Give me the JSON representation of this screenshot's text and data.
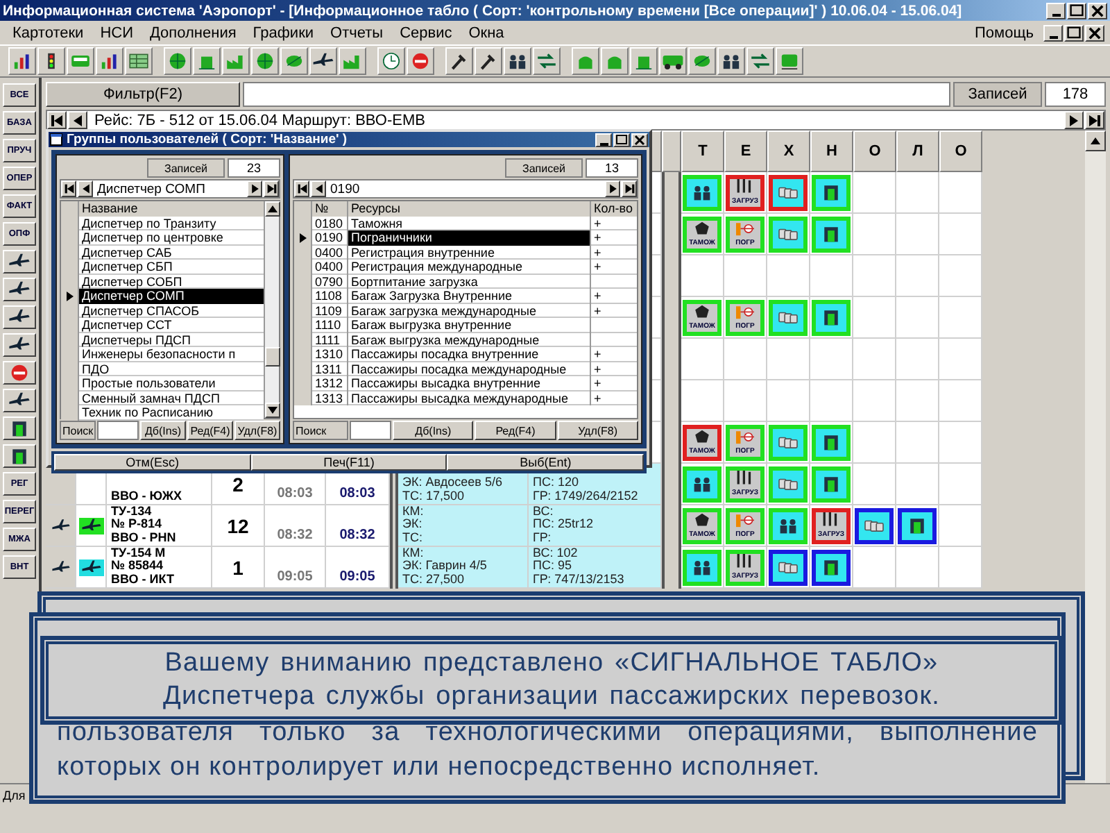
{
  "window": {
    "title": "Информационная система 'Аэропорт' - [Информационное табло ( Сорт: 'контрольному времени [Все операции]' ) 10.06.04 - 15.06.04]"
  },
  "menu": {
    "items": [
      "Картотеки",
      "НСИ",
      "Дополнения",
      "Графики",
      "Отчеты",
      "Сервис",
      "Окна"
    ],
    "help": "Помощь"
  },
  "toolbar": {
    "groups": [
      [
        {
          "kind": "chart"
        },
        {
          "kind": "traffic-light"
        },
        {
          "kind": "bus"
        },
        {
          "kind": "chart"
        },
        {
          "kind": "table"
        }
      ],
      [
        {
          "kind": "globe"
        },
        {
          "kind": "building"
        },
        {
          "kind": "factory"
        },
        {
          "kind": "globe"
        },
        {
          "kind": "leaf"
        },
        {
          "kind": "plane"
        },
        {
          "kind": "factory"
        }
      ],
      [
        {
          "kind": "clock"
        },
        {
          "kind": "no-entry"
        }
      ],
      [
        {
          "kind": "hammer"
        },
        {
          "kind": "hammer"
        },
        {
          "kind": "people"
        },
        {
          "kind": "arrows"
        }
      ],
      [
        {
          "kind": "bag"
        },
        {
          "kind": "bag"
        },
        {
          "kind": "building"
        },
        {
          "kind": "car"
        },
        {
          "kind": "leaf"
        },
        {
          "kind": "people"
        },
        {
          "kind": "arrows"
        },
        {
          "kind": "train"
        }
      ]
    ]
  },
  "sidebar": {
    "items": [
      {
        "kind": "text",
        "label": "ВСЕ"
      },
      {
        "kind": "text",
        "label": "БАЗА"
      },
      {
        "kind": "text",
        "label": "ПРУЧ"
      },
      {
        "kind": "text",
        "label": "ОПЕР"
      },
      {
        "kind": "text",
        "label": "ФАКТ"
      },
      {
        "kind": "text",
        "label": "ОПФ"
      },
      {
        "kind": "plane"
      },
      {
        "kind": "plane"
      },
      {
        "kind": "plane"
      },
      {
        "kind": "plane"
      },
      {
        "kind": "no-entry"
      },
      {
        "kind": "plane"
      },
      {
        "kind": "gate"
      },
      {
        "kind": "gate"
      },
      {
        "kind": "text",
        "label": "РЕГ"
      },
      {
        "kind": "text",
        "label": "ПЕРЕГ"
      },
      {
        "kind": "text",
        "label": "МЖА"
      },
      {
        "kind": "text",
        "label": "ВНТ"
      }
    ]
  },
  "filter": {
    "button": "Фильтр(F2)",
    "records_label": "Записей",
    "records": "178"
  },
  "nav": {
    "text": "Рейс: 7Б - 512 от 15.06.04 Маршрут: ВВО-ЕМВ"
  },
  "board": {
    "op_columns": [
      "Т",
      "Е",
      "Х",
      "Н",
      "О",
      "Л",
      "О"
    ],
    "rows": [
      {
        "ops": [
          {
            "kind": "people",
            "color": "#22e022"
          },
          {
            "kind": "food",
            "label": "ЗАГРУЗ",
            "color": "#e02020"
          },
          {
            "kind": "bags",
            "color": "#e02020"
          },
          {
            "kind": "gate",
            "color": "#22e022"
          }
        ]
      },
      {
        "ops": [
          {
            "kind": "customs",
            "label": "ТАМОЖ",
            "color": "#22e022"
          },
          {
            "kind": "border",
            "label": "ПОГР",
            "color": "#22e022"
          },
          {
            "kind": "bags",
            "color": "#22e022"
          },
          {
            "kind": "gate",
            "color": "#22e022"
          }
        ]
      },
      {
        "ops": []
      },
      {
        "ops": [
          {
            "kind": "customs",
            "label": "ТАМОЖ",
            "color": "#22e022"
          },
          {
            "kind": "border",
            "label": "ПОГР",
            "color": "#22e022"
          },
          {
            "kind": "bags",
            "color": "#22e022"
          },
          {
            "kind": "gate",
            "color": "#22e022"
          }
        ]
      },
      {
        "ops": []
      },
      {
        "ops": []
      },
      {
        "ops": [
          {
            "kind": "customs",
            "label": "ТАМОЖ",
            "color": "#e02020"
          },
          {
            "kind": "border",
            "label": "ПОГР",
            "color": "#22e022"
          },
          {
            "kind": "bags",
            "color": "#22e022"
          },
          {
            "kind": "gate",
            "color": "#22e022"
          }
        ]
      },
      {
        "flight": {
          "lines": [
            "ВВО - ЮЖХ"
          ],
          "count": "2",
          "time_plan": "08:03",
          "time_fact": "08:03",
          "crew": [
            "ЭК: Авдосеев 5/6",
            "ТС: 17,500"
          ],
          "info": [
            "ПС: 120",
            "ГР: 1749/264/2152"
          ]
        },
        "ops": [
          {
            "kind": "people",
            "color": "#22e022"
          },
          {
            "kind": "food",
            "label": "ЗАГРУЗ",
            "color": "#22e022"
          },
          {
            "kind": "bags",
            "color": "#22e022"
          },
          {
            "kind": "gate",
            "color": "#22e022"
          }
        ]
      },
      {
        "flight": {
          "color": "#22e022",
          "lines": [
            "ТУ-134",
            "№ Р-814",
            "ВВО - PHN"
          ],
          "count": "12",
          "time_plan": "08:32",
          "time_fact": "08:32",
          "crew": [
            "КМ:",
            "ЭК:",
            "ТС:"
          ],
          "info": [
            "ВС:",
            "ПС: 25tr12",
            "ГР:"
          ]
        },
        "ops": [
          {
            "kind": "customs",
            "label": "ТАМОЖ",
            "color": "#22e022"
          },
          {
            "kind": "border",
            "label": "ПОГР",
            "color": "#22e022"
          },
          {
            "kind": "people",
            "color": "#22e022"
          },
          {
            "kind": "food",
            "label": "ЗАГРУЗ",
            "color": "#e02020"
          },
          {
            "kind": "bags",
            "color": "#1a1ae0"
          },
          {
            "kind": "gate",
            "color": "#1a1ae0"
          }
        ]
      },
      {
        "flight": {
          "color": "#22dde0",
          "lines": [
            "ТУ-154 М",
            "№ 85844",
            "ВВО - ИКТ"
          ],
          "count": "1",
          "time_plan": "09:05",
          "time_fact": "09:05",
          "crew": [
            "КМ:",
            "ЭК: Гаврин 4/5",
            "ТС: 27,500"
          ],
          "info": [
            "ВС: 102",
            "ПС: 95",
            "ГР: 747/13/2153"
          ]
        },
        "ops": [
          {
            "kind": "people",
            "color": "#22e022"
          },
          {
            "kind": "food",
            "label": "ЗАГРУЗ",
            "color": "#22e022"
          },
          {
            "kind": "bags",
            "color": "#1a1ae0"
          },
          {
            "kind": "gate",
            "color": "#1a1ae0"
          }
        ]
      }
    ]
  },
  "dialog": {
    "title": "Группы пользователей ( Сорт: 'Название' )",
    "groups": {
      "records_label": "Записей",
      "records": "23",
      "current": "Диспетчер СОМП",
      "column": "Название",
      "items": [
        {
          "name": "Диспетчер по Транзиту",
          "selected": false
        },
        {
          "name": "Диспетчер по центровке",
          "selected": false
        },
        {
          "name": "Диспетчер САБ",
          "selected": false
        },
        {
          "name": "Диспетчер СБП",
          "selected": false
        },
        {
          "name": "Диспетчер СОБП",
          "selected": false
        },
        {
          "name": "Диспетчер СОМП",
          "selected": true
        },
        {
          "name": "Диспетчер СПАСОБ",
          "selected": false
        },
        {
          "name": "Диспетчер ССТ",
          "selected": false
        },
        {
          "name": "Диспетчеры ПДСП",
          "selected": false
        },
        {
          "name": "Инженеры безопасности п",
          "selected": false
        },
        {
          "name": "ПДО",
          "selected": false
        },
        {
          "name": "Простые пользователи",
          "selected": false
        },
        {
          "name": "Сменный замнач ПДСП",
          "selected": false
        },
        {
          "name": "Техник по Расписанию",
          "selected": false
        }
      ],
      "search_label": "Поиск",
      "buttons": [
        "Дб(Ins)",
        "Ред(F4)",
        "Удл(F8)"
      ]
    },
    "resources": {
      "records_label": "Записей",
      "records": "13",
      "current": "0190",
      "columns": [
        "№",
        "Ресурсы",
        "Кол-во"
      ],
      "rows": [
        {
          "code": "0180",
          "name": "Таможня",
          "qty": "+",
          "selected": false
        },
        {
          "code": "0190",
          "name": "Пограничники",
          "qty": "+",
          "selected": true
        },
        {
          "code": "0400",
          "name": "Регистрация внутренние",
          "qty": "+",
          "selected": false
        },
        {
          "code": "0400",
          "name": "Регистрация международные",
          "qty": "+",
          "selected": false
        },
        {
          "code": "0790",
          "name": "Бортпитание загрузка",
          "selected": false
        },
        {
          "code": "1108",
          "name": "Багаж Загрузка Внутренние",
          "qty": "+",
          "selected": false
        },
        {
          "code": "1109",
          "name": "Багаж загрузка международные",
          "qty": "+",
          "selected": false
        },
        {
          "code": "1110",
          "name": "Багаж выгрузка внутренние",
          "selected": false
        },
        {
          "code": "1111",
          "name": "Багаж выгрузка международные",
          "selected": false
        },
        {
          "code": "1310",
          "name": "Пассажиры посадка внутренние",
          "qty": "+",
          "selected": false
        },
        {
          "code": "1311",
          "name": "Пассажиры посадка международные",
          "qty": "+",
          "selected": false
        },
        {
          "code": "1312",
          "name": "Пассажиры высадка внутренние",
          "qty": "+",
          "selected": false
        },
        {
          "code": "1313",
          "name": "Пассажиры высадка международные",
          "qty": "+",
          "selected": false
        }
      ],
      "search_label": "Поиск",
      "buttons": [
        "Дб(Ins)",
        "Ред(F4)",
        "Удл(F8)"
      ]
    },
    "footer": [
      "Отм(Esc)",
      "Печ(F11)",
      "Выб(Ent)"
    ]
  },
  "notice": {
    "paragraph": "пользователя только за технологическими операциями, выполнение которых он контролирует или непосредственно исполняет.",
    "title_lines": [
      "Вашему вниманию представлено «СИГНАЛЬНОЕ ТАБЛО»",
      "Диспетчера службы организации пассажирских перевозок."
    ]
  },
  "status_bar": {
    "text": "Для"
  }
}
